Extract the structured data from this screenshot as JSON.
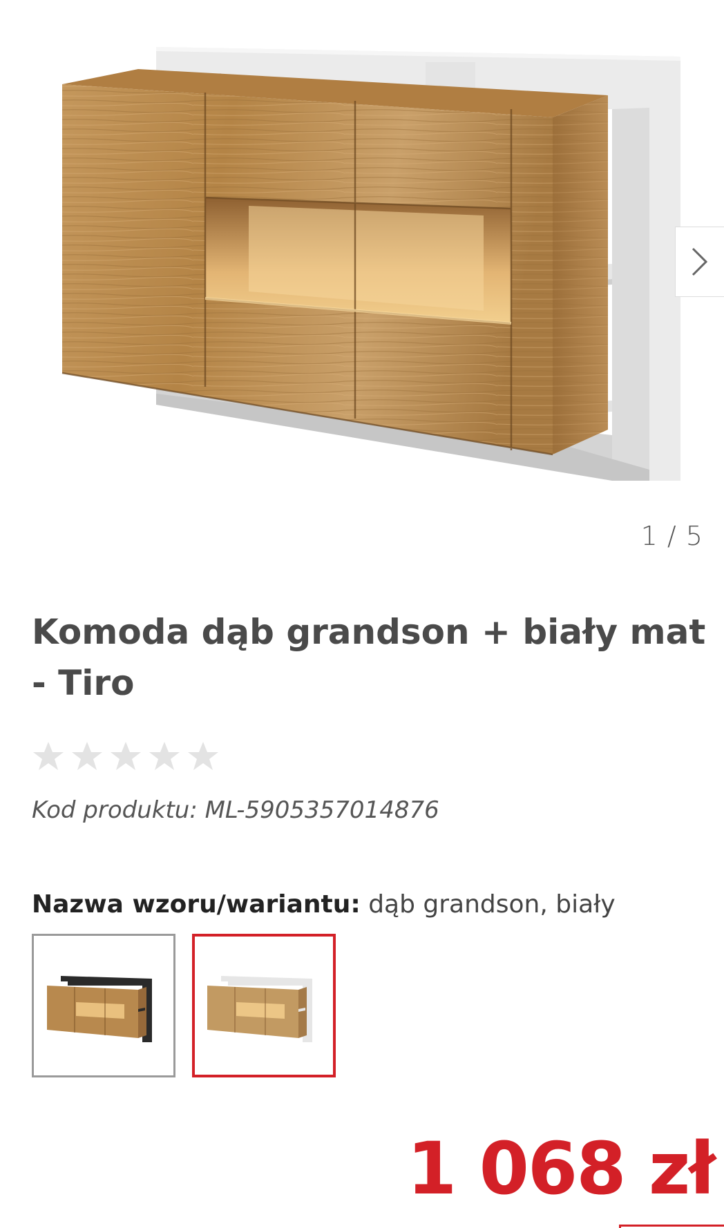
{
  "gallery": {
    "image_alt": "Komoda dąb grandson + biały mat - Tiro",
    "counter": "1 / 5",
    "next_icon": "chevron-right-icon"
  },
  "product": {
    "title": "Komoda dąb grandson + biały mat - Tiro",
    "rating": {
      "value": 0,
      "max": 5
    },
    "code": "Kod produktu: ML-5905357014876"
  },
  "variant": {
    "label": "Nazwa wzoru/wariantu:",
    "value": "dąb grandson, biały",
    "options": [
      {
        "frame": "black",
        "selected": false
      },
      {
        "frame": "white",
        "selected": true
      }
    ]
  },
  "price": {
    "text": "1 068 zł"
  },
  "colors": {
    "accent": "#d32027",
    "star_empty": "#e3e3e3",
    "oak": "#b8894e",
    "frame_white": "#e8e8e8",
    "frame_black": "#2a2a2a"
  }
}
